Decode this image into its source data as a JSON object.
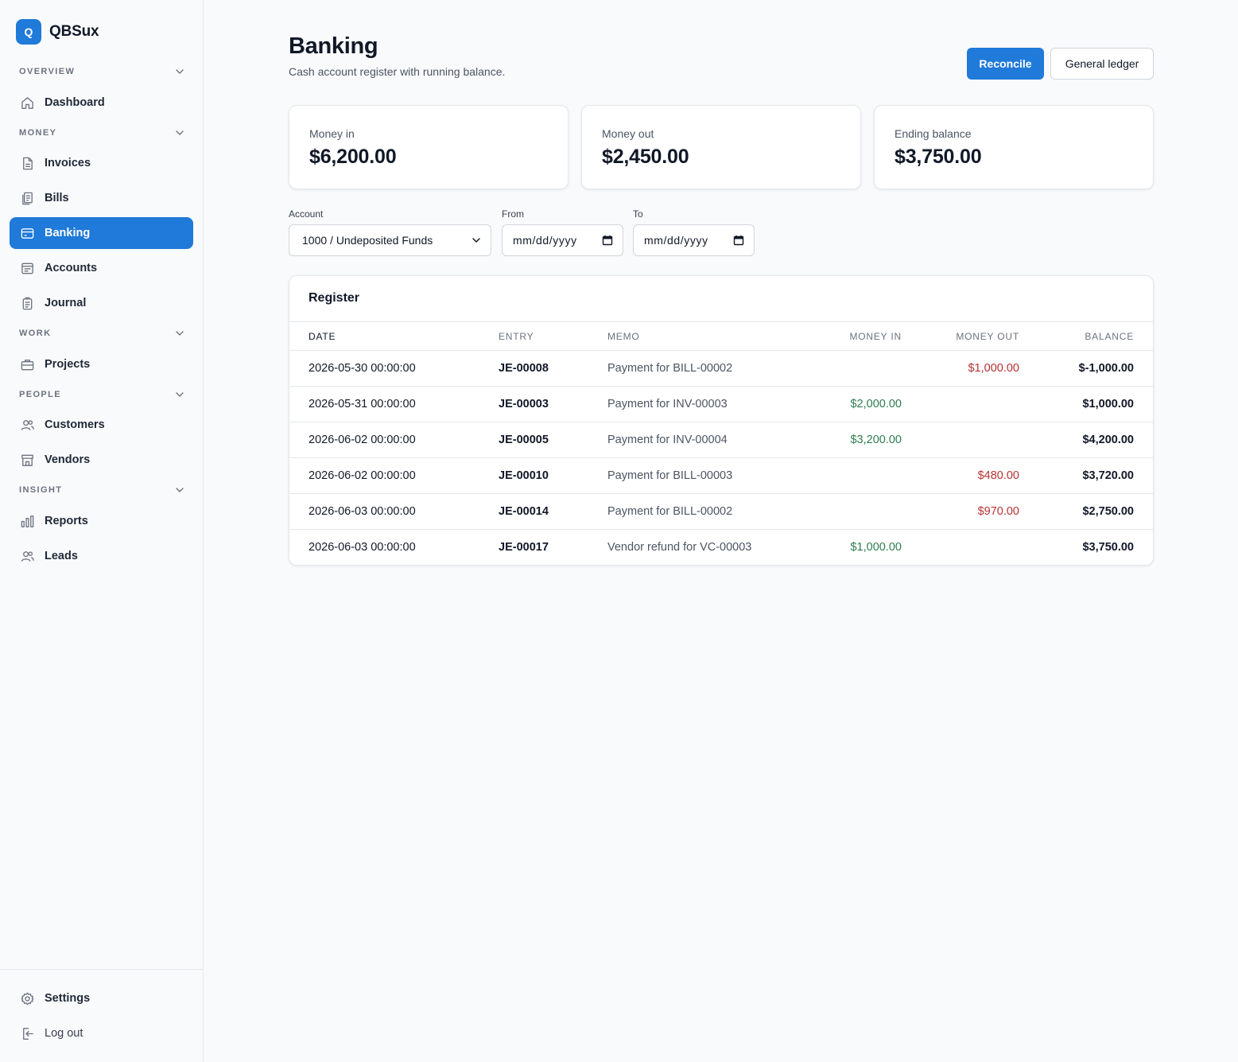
{
  "app": {
    "logo_letter": "Q",
    "name": "QBSux"
  },
  "sidebar": {
    "sections": [
      {
        "label": "OVERVIEW",
        "items": [
          {
            "label": "Dashboard",
            "icon": "home-icon"
          }
        ]
      },
      {
        "label": "MONEY",
        "items": [
          {
            "label": "Invoices",
            "icon": "file-icon"
          },
          {
            "label": "Bills",
            "icon": "receipt-icon"
          },
          {
            "label": "Banking",
            "icon": "bank-card-icon",
            "active": true
          },
          {
            "label": "Accounts",
            "icon": "ledger-icon"
          },
          {
            "label": "Journal",
            "icon": "journal-icon"
          }
        ]
      },
      {
        "label": "WORK",
        "items": [
          {
            "label": "Projects",
            "icon": "briefcase-icon"
          }
        ]
      },
      {
        "label": "PEOPLE",
        "items": [
          {
            "label": "Customers",
            "icon": "users-icon"
          },
          {
            "label": "Vendors",
            "icon": "store-icon"
          }
        ]
      },
      {
        "label": "INSIGHT",
        "items": [
          {
            "label": "Reports",
            "icon": "bar-chart-icon"
          },
          {
            "label": "Leads",
            "icon": "users-icon"
          }
        ]
      }
    ],
    "footer": {
      "settings": "Settings",
      "logout": "Log out"
    }
  },
  "page": {
    "title": "Banking",
    "subtitle": "Cash account register with running balance.",
    "reconcile_label": "Reconcile",
    "ledger_label": "General ledger"
  },
  "stats": [
    {
      "label": "Money in",
      "value": "$6,200.00"
    },
    {
      "label": "Money out",
      "value": "$2,450.00"
    },
    {
      "label": "Ending balance",
      "value": "$3,750.00"
    }
  ],
  "filters": {
    "account_label": "Account",
    "account_value": "1000 / Undeposited Funds",
    "from_label": "From",
    "from_placeholder": "mm/dd/yyyy",
    "to_label": "To",
    "to_placeholder": "mm/dd/yyyy"
  },
  "register": {
    "title": "Register",
    "columns": {
      "date": "DATE",
      "entry": "ENTRY",
      "memo": "MEMO",
      "money_in": "MONEY IN",
      "money_out": "MONEY OUT",
      "balance": "BALANCE"
    },
    "rows": [
      {
        "date": "2026-05-30 00:00:00",
        "entry": "JE-00008",
        "memo": "Payment for BILL-00002",
        "money_in": "",
        "money_out": "$1,000.00",
        "balance": "$-1,000.00"
      },
      {
        "date": "2026-05-31 00:00:00",
        "entry": "JE-00003",
        "memo": "Payment for INV-00003",
        "money_in": "$2,000.00",
        "money_out": "",
        "balance": "$1,000.00"
      },
      {
        "date": "2026-06-02 00:00:00",
        "entry": "JE-00005",
        "memo": "Payment for INV-00004",
        "money_in": "$3,200.00",
        "money_out": "",
        "balance": "$4,200.00"
      },
      {
        "date": "2026-06-02 00:00:00",
        "entry": "JE-00010",
        "memo": "Payment for BILL-00003",
        "money_in": "",
        "money_out": "$480.00",
        "balance": "$3,720.00"
      },
      {
        "date": "2026-06-03 00:00:00",
        "entry": "JE-00014",
        "memo": "Payment for BILL-00002",
        "money_in": "",
        "money_out": "$970.00",
        "balance": "$2,750.00"
      },
      {
        "date": "2026-06-03 00:00:00",
        "entry": "JE-00017",
        "memo": "Vendor refund for VC-00003",
        "money_in": "$1,000.00",
        "money_out": "",
        "balance": "$3,750.00"
      }
    ]
  },
  "colors": {
    "accent": "#1f7ad9",
    "money_in": "#2e7d4f",
    "money_out": "#b83232"
  }
}
